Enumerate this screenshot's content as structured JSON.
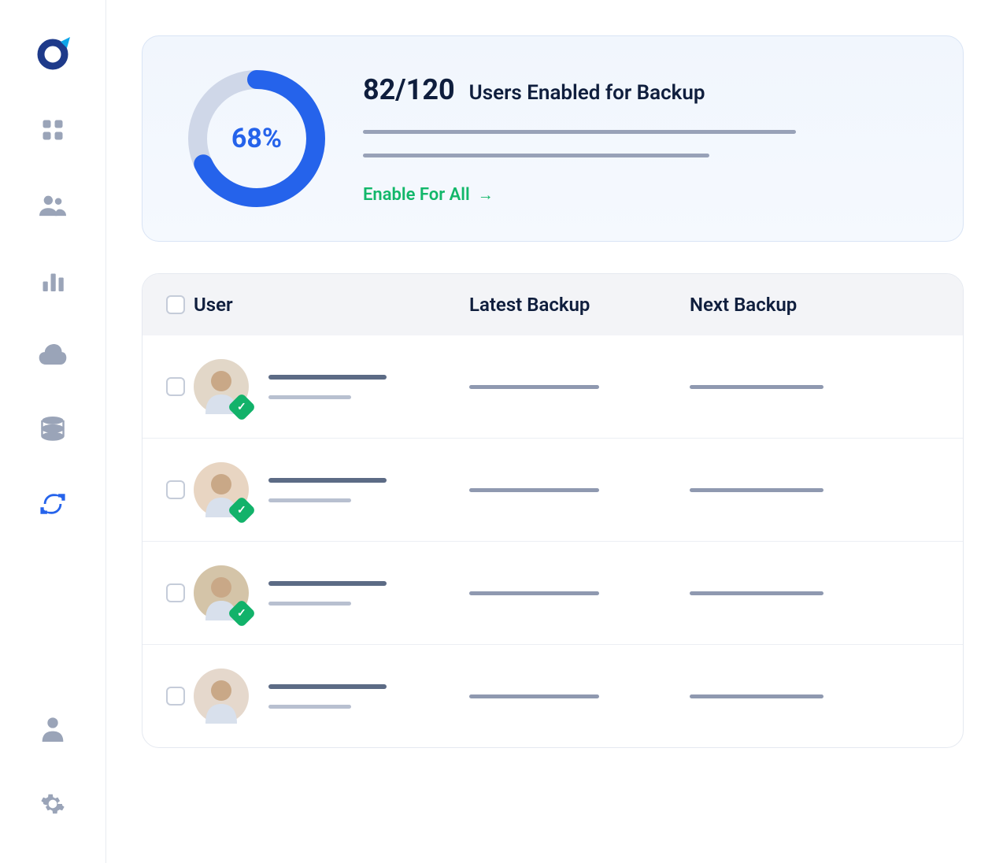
{
  "sidebar": {
    "nav": [
      {
        "name": "dashboard",
        "active": false
      },
      {
        "name": "users",
        "active": false
      },
      {
        "name": "analytics",
        "active": false
      },
      {
        "name": "cloud",
        "active": false
      },
      {
        "name": "database",
        "active": false
      },
      {
        "name": "sync",
        "active": true
      }
    ],
    "bottom": [
      {
        "name": "profile"
      },
      {
        "name": "settings"
      }
    ]
  },
  "summary": {
    "percent": 68,
    "percent_label": "68%",
    "fraction": "82/120",
    "label": "Users Enabled for Backup",
    "cta": "Enable For All"
  },
  "table": {
    "headers": {
      "user": "User",
      "latest": "Latest Backup",
      "next": "Next Backup"
    },
    "rows": [
      {
        "verified": true,
        "avatar_bg": "#e2d7c8"
      },
      {
        "verified": true,
        "avatar_bg": "#e8d5c2"
      },
      {
        "verified": true,
        "avatar_bg": "#d4c4a8"
      },
      {
        "verified": false,
        "avatar_bg": "#e5d8cc"
      }
    ]
  },
  "colors": {
    "accent": "#2563eb",
    "ring_track": "#cfd7e8",
    "success": "#12b76a"
  }
}
